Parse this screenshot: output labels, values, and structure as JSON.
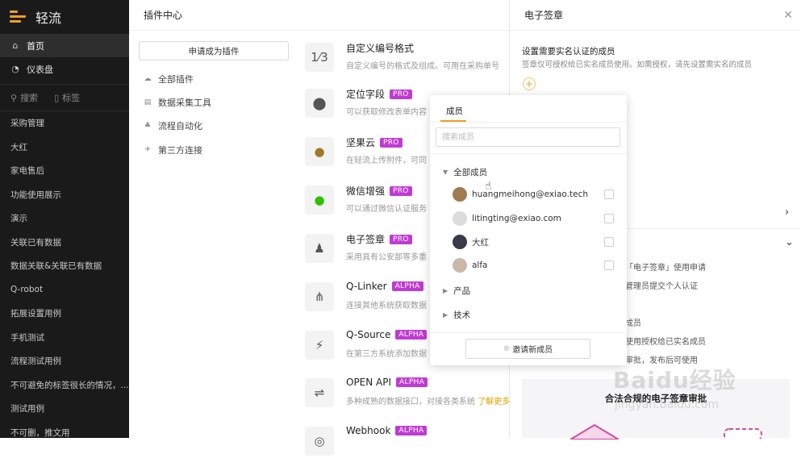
{
  "app": {
    "logo_text": "轻流"
  },
  "sidebar": {
    "nav": [
      {
        "label": "首页",
        "icon": "home-icon"
      },
      {
        "label": "仪表盘",
        "icon": "dashboard-icon"
      }
    ],
    "search_label": "搜索",
    "tags_label": "标签",
    "items": [
      "采购管理",
      "大红",
      "家电售后",
      "功能使用展示",
      "演示",
      "关联已有数据",
      "数据关联&关联已有数据",
      "Q-robot",
      "拓展设置用例",
      "手机测试",
      "流程测试用例",
      "不可避免的标签很长的情况，...",
      "测试用例",
      "不可删，推文用"
    ]
  },
  "plugin_center": {
    "title": "插件中心",
    "apply_button": "申请成为插件",
    "categories": [
      {
        "label": "全部插件",
        "icon": "cloud-icon"
      },
      {
        "label": "数据采集工具",
        "icon": "database-icon"
      },
      {
        "label": "流程自动化",
        "icon": "flow-icon"
      },
      {
        "label": "第三方连接",
        "icon": "rocket-icon"
      }
    ],
    "plugins": [
      {
        "name": "自定义编号格式",
        "badge": "",
        "desc": "自定义编号的格式及组成。可用在采购单号",
        "icon": "number-format-icon",
        "glyph": "1⁄3"
      },
      {
        "name": "定位字段",
        "badge": "PRO",
        "desc": "可以获取修改表单内容",
        "icon": "location-pin-icon",
        "glyph": "⬤"
      },
      {
        "name": "坚果云",
        "badge": "PRO",
        "desc": "在轻流上传附件，可同",
        "icon": "nut-cloud-icon",
        "glyph": "●"
      },
      {
        "name": "微信增强",
        "badge": "PRO",
        "desc": "可以通过微信认证服务",
        "icon": "wechat-icon",
        "glyph": "●"
      },
      {
        "name": "电子签章",
        "badge": "PRO",
        "desc": "采用具有公安部等多重",
        "icon": "stamp-icon",
        "glyph": "♟"
      },
      {
        "name": "Q-Linker",
        "badge": "ALPHA",
        "desc": "连接其他系统获取数据",
        "icon": "share-nodes-icon",
        "glyph": "⋔"
      },
      {
        "name": "Q-Source",
        "badge": "ALPHA",
        "desc": "在第三方系统添加数据",
        "icon": "plug-icon",
        "glyph": "⚡"
      },
      {
        "name": "OPEN API",
        "badge": "ALPHA",
        "desc": "多种成熟的数据接口，对接各类系统",
        "link": "了解更多",
        "icon": "api-icon",
        "glyph": "⇌"
      },
      {
        "name": "Webhook",
        "badge": "ALPHA",
        "desc": "",
        "icon": "webhook-icon",
        "glyph": "◎"
      }
    ]
  },
  "right_panel": {
    "title": "电子签章",
    "section_title": "设置需要实名认证的成员",
    "section_desc": "签章仅可授权给已实名成员使用。如需授权，请先设置需实名的成员",
    "lines": [
      "「电子签章」使用申请",
      "管理员提交个人认证",
      "成员",
      "使用授权给已实名成员",
      "审批，发布后可使用"
    ],
    "card_title": "合法合规的电子签章审批"
  },
  "dropdown": {
    "tab": "成员",
    "search_placeholder": "搜索成员",
    "all_members": "全部成员",
    "members": [
      {
        "name": "huangmeihong@exiao.tech",
        "avatar_color": "#a07a50"
      },
      {
        "name": "litingting@exiao.com",
        "avatar_color": "#dcdcdc"
      },
      {
        "name": "大红",
        "avatar_color": "#3a3a4a"
      },
      {
        "name": "alfa",
        "avatar_color": "#c9b8a8"
      }
    ],
    "groups": [
      "产品",
      "技术"
    ],
    "invite_button": "邀请新成员"
  },
  "watermark": {
    "text": "Baidu经验",
    "sub": "jingyan.baidu.com"
  }
}
